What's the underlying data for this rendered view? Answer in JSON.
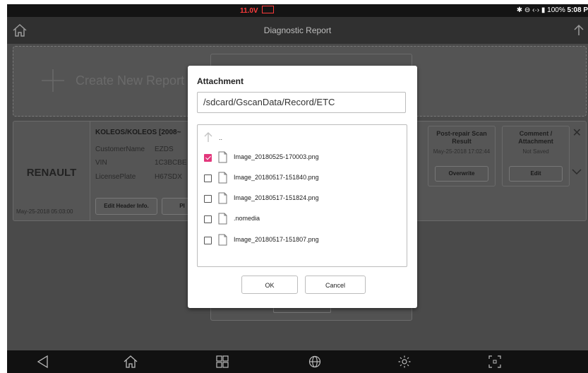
{
  "status_bar": {
    "voltage": "11.0V",
    "battery_percent": "100%",
    "clock": "5:08 P"
  },
  "app_bar": {
    "title": "Diagnostic Report"
  },
  "create_report": {
    "label": "Create New Report"
  },
  "report_card": {
    "make": "RENAULT",
    "model": "KOLEOS/KOLEOS [2008~",
    "fields": [
      {
        "label": "CustomerName",
        "value": "EZDS"
      },
      {
        "label": "VIN",
        "value": "1C3BCBE"
      },
      {
        "label": "LicensePlate",
        "value": "H67SDX"
      }
    ],
    "date": "May-25-2018 05:03:00",
    "edit_header_label": "Edit Header Info.",
    "second_button_label": "PI",
    "post_repair": {
      "title": "Post-repair Scan Result",
      "date": "May-25-2018 17:02:44",
      "button": "Overwrite"
    },
    "comment": {
      "title": "Comment / Attachment",
      "status": "Not Saved",
      "button": "Edit"
    }
  },
  "dialog": {
    "title": "Attachment",
    "path": "/sdcard/GscanData/Record/ETC",
    "parent_label": "..",
    "files": [
      {
        "name": "Image_20180525-170003.png",
        "checked": true
      },
      {
        "name": "Image_20180517-151840.png",
        "checked": false
      },
      {
        "name": "Image_20180517-151824.png",
        "checked": false
      },
      {
        "name": ".nomedia",
        "checked": false
      },
      {
        "name": "Image_20180517-151807.png",
        "checked": false
      }
    ],
    "ok_label": "OK",
    "cancel_label": "Cancel"
  },
  "colors": {
    "checkbox_checked": "#e3377c",
    "voltage": "#ff3b3b"
  }
}
